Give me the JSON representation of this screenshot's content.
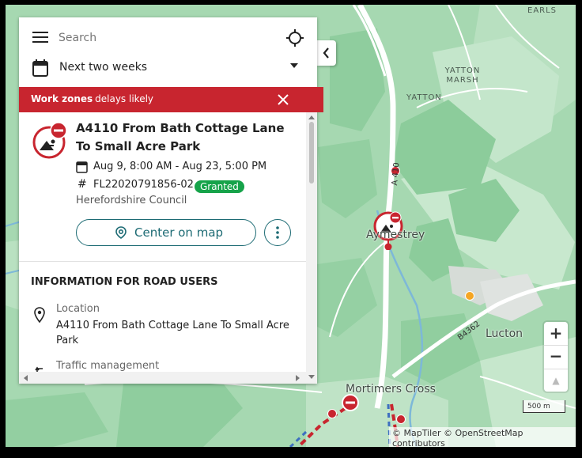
{
  "search": {
    "placeholder": "Search"
  },
  "date_filter": {
    "value": "Next two weeks"
  },
  "banner": {
    "bold": "Work zones",
    "rest": "- delays likely"
  },
  "work": {
    "title": "A4110 From Bath Cottage Lane To Small Acre Park",
    "dates": "Aug 9, 8:00 AM - Aug 23, 5:00 PM",
    "reference": "FL22020791856-02",
    "status": "Granted",
    "authority": "Herefordshire Council",
    "center_label": "Center on map"
  },
  "info": {
    "heading": "INFORMATION FOR ROAD USERS",
    "location_label": "Location",
    "location_value": "A4110 From Bath Cottage Lane To Small Acre Park",
    "traffic_label": "Traffic management"
  },
  "map": {
    "places": [
      "EARLS",
      "YATTON MARSH",
      "YATTON",
      "Aymestrey",
      "Lucton",
      "Mortimers Cross"
    ],
    "roads": [
      "A 410",
      "B4362"
    ],
    "scale": "500 m",
    "attribution": "© MapTiler © OpenStreetMap contributors"
  },
  "colors": {
    "banner": "#c8252f",
    "accent": "#1d6b74",
    "granted": "#16a34a",
    "map_green": "#a6d8b1",
    "forest": "#8ccc9b"
  }
}
